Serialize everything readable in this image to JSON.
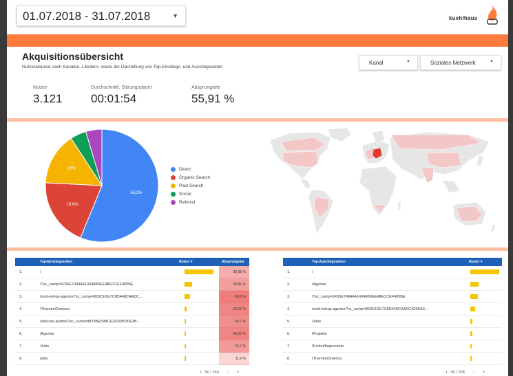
{
  "header": {
    "date_range": "01.07.2018 - 31.07.2018",
    "logo_text": "kuehlhaus"
  },
  "overview": {
    "title": "Akquisitionsübersicht",
    "subtitle": "Nutzerakquise nach Kanälen, Ländern, sowie der Darstellung von Top-Einstiegs- und Ausstiegsseiten",
    "filters": {
      "channel": "Kanal",
      "network": "Soziales Netzwerk"
    },
    "kpis": [
      {
        "label": "Nutzer",
        "value": "3.121"
      },
      {
        "label": "Durchschnittl. Sitzungsdauer",
        "value": "00:01:54"
      },
      {
        "label": "Absprungrate",
        "value": "55,91 %"
      }
    ]
  },
  "chart_data": {
    "type": "pie",
    "slices": [
      {
        "name": "Direct",
        "value": 56.2,
        "label": "56,2%",
        "color": "#4285f4"
      },
      {
        "name": "Organic Search",
        "value": 19.6,
        "label": "19,6%",
        "color": "#db4437"
      },
      {
        "name": "Paid Search",
        "value": 15,
        "label": "15%",
        "color": "#f4b400"
      },
      {
        "name": "Social",
        "value": 4.6,
        "label": "",
        "color": "#0f9d58"
      },
      {
        "name": "Referral",
        "value": 4.6,
        "label": "",
        "color": "#ab47bc"
      }
    ]
  },
  "map": {
    "highlight_color": "#e53935",
    "shade_color": "#f4c7c7",
    "base_color": "#e6e6e6"
  },
  "entry_table": {
    "headers": {
      "page": "Top-Einstiegsseiten",
      "users": "Nutzer ▾",
      "bounce": "Absprungrate"
    },
    "rows": [
      {
        "idx": "1.",
        "page": "/",
        "users": 1.0,
        "bounce": "39,06 %",
        "shade": 0.39
      },
      {
        "idx": "2.",
        "page": "/?sc_camp=6F55E7494A414046B0EE48ECCEF495BE",
        "users": 0.25,
        "bounce": "50,81 %",
        "shade": 0.5
      },
      {
        "idx": "3.",
        "page": "/ovid-eshop-agentur?sc_camp=80DCE1E7C8D448CAADC...",
        "users": 0.18,
        "bounce": "69,9 %",
        "shade": 0.72
      },
      {
        "idx": "4.",
        "page": "/Themen/Dmexco",
        "users": 0.06,
        "bounce": "63,22 %",
        "shade": 0.65
      },
      {
        "idx": "5.",
        "page": "/sitecore-partner?sc_camp=8829BE54BCF2431B930E3B...",
        "users": 0.05,
        "bounce": "59,7 %",
        "shade": 0.6
      },
      {
        "idx": "6.",
        "page": "/Agentur",
        "users": 0.04,
        "bounce": "64,22 %",
        "shade": 0.66
      },
      {
        "idx": "7.",
        "page": "/Jobs",
        "users": 0.03,
        "bounce": "52,7 %",
        "shade": 0.52
      },
      {
        "idx": "8.",
        "page": "/jobs",
        "users": 0.03,
        "bounce": "11,9 %",
        "shade": 0.12
      }
    ],
    "pagination": "1 - 50 / 260"
  },
  "exit_table": {
    "headers": {
      "page": "Top-Ausstiegsseiten",
      "users": "Nutzer ▾"
    },
    "rows": [
      {
        "idx": "1.",
        "page": "/",
        "users": 1.0
      },
      {
        "idx": "2.",
        "page": "/Agentur",
        "users": 0.28
      },
      {
        "idx": "3.",
        "page": "/?sc_camp=6F55E7494A414046B0EE48ECCEF495BE",
        "users": 0.26
      },
      {
        "idx": "4.",
        "page": "/ovid-eshop-agentur?sc_camp=80DCE1E7C8D448CAADC4E06A0...",
        "users": 0.16
      },
      {
        "idx": "5.",
        "page": "/Jobs",
        "users": 0.07
      },
      {
        "idx": "6.",
        "page": "/Projekte",
        "users": 0.06
      },
      {
        "idx": "7.",
        "page": "/Footer/Impressum",
        "users": 0.05
      },
      {
        "idx": "8.",
        "page": "/Themen/Dmexco",
        "users": 0.05
      }
    ],
    "pagination": "1 - 50 / 258"
  }
}
